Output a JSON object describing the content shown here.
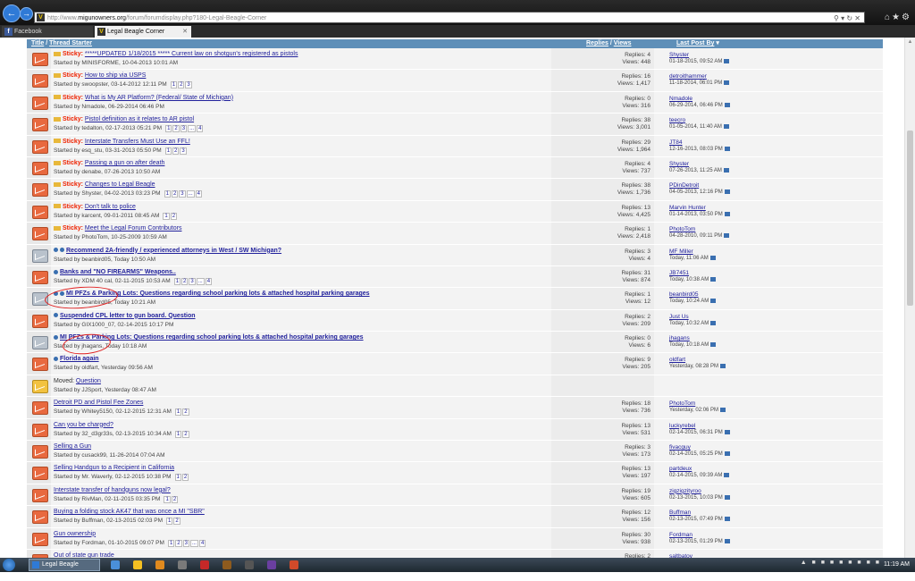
{
  "browser": {
    "url_prefix": "http://www.",
    "url_host": "migunowners.org",
    "url_path": "/forum/forumdisplay.php?180-Legal-Beagle-Corner",
    "tabs": [
      {
        "label": "Facebook"
      },
      {
        "label": "Legal Beagle Corner"
      }
    ]
  },
  "header": {
    "title": "Title",
    "thread_starter": "Thread Starter",
    "replies": "Replies",
    "views": "Views",
    "last_post_by": "Last Post By"
  },
  "threads": [
    {
      "icon": "red",
      "sticky": true,
      "folder": true,
      "title": "*****UPDATED 1/18/2015 ***** Current law on shotgun's registered as pistols",
      "started": "Started by MINISFORME, 10-04-2013 10:01 AM",
      "pages": [],
      "replies": "Replies: 4",
      "views": "Views: 448",
      "last_user": "Shyster",
      "last_date": "01-18-2015, 09:52 AM"
    },
    {
      "icon": "red",
      "sticky": true,
      "folder": true,
      "title": "How to ship via USPS",
      "started": "Started by swoopster, 03-14-2012 12:11 PM",
      "pages": [
        "1",
        "2",
        "3"
      ],
      "replies": "Replies: 16",
      "views": "Views: 1,417",
      "last_user": "detroithammer",
      "last_date": "11-18-2014, 06:01 PM"
    },
    {
      "icon": "red",
      "sticky": true,
      "folder": true,
      "title": "What is My AR Platform? (Federal/ State of Michigan)",
      "started": "Started by Nmadole, 06-29-2014 06:46 PM",
      "pages": [],
      "replies": "Replies: 0",
      "views": "Views: 316",
      "last_user": "Nmadole",
      "last_date": "06-29-2014, 06:46 PM"
    },
    {
      "icon": "red",
      "sticky": true,
      "folder": true,
      "title": "Pistol definition as it relates to AR pistol",
      "started": "Started by tedalton, 02-17-2013 05:21 PM",
      "pages": [
        "1",
        "2",
        "3",
        "...",
        "4"
      ],
      "replies": "Replies: 38",
      "views": "Views: 3,001",
      "last_user": "teecro",
      "last_date": "01-05-2014, 11:40 AM"
    },
    {
      "icon": "red",
      "sticky": true,
      "folder": true,
      "title": "Interstate Transfers Must Use an FFL!",
      "started": "Started by esq_stu, 03-31-2013 05:50 PM",
      "pages": [
        "1",
        "2",
        "3"
      ],
      "replies": "Replies: 29",
      "views": "Views: 1,964",
      "last_user": "JT84",
      "last_date": "12-16-2013, 08:03 PM"
    },
    {
      "icon": "red",
      "sticky": true,
      "folder": true,
      "title": "Passing a gun on after death",
      "started": "Started by denabe, 07-26-2013 10:50 AM",
      "pages": [],
      "replies": "Replies: 4",
      "views": "Views: 737",
      "last_user": "Shyster",
      "last_date": "07-26-2013, 11:25 AM"
    },
    {
      "icon": "red",
      "sticky": true,
      "folder": true,
      "title": "Changes to Legal Beagle",
      "started": "Started by Shyster, 04-02-2013 03:23 PM",
      "pages": [
        "1",
        "2",
        "3",
        "...",
        "4"
      ],
      "replies": "Replies: 38",
      "views": "Views: 1,736",
      "last_user": "PDinDetroit",
      "last_date": "04-05-2013, 12:16 PM"
    },
    {
      "icon": "red",
      "sticky": true,
      "folder": true,
      "title": "Don't talk to police",
      "started": "Started by karcent, 09-01-2011 08:45 AM",
      "pages": [
        "1",
        "2"
      ],
      "replies": "Replies: 13",
      "views": "Views: 4,425",
      "last_user": "Marvin Hunter",
      "last_date": "01-14-2013, 03:50 PM"
    },
    {
      "icon": "red",
      "sticky": true,
      "folder": true,
      "title": "Meet the Legal Forum Contributors",
      "started": "Started by PhotoTom, 10-25-2009 10:59 AM",
      "pages": [],
      "replies": "Replies: 1",
      "views": "Views: 2,418",
      "last_user": "PhotoTom",
      "last_date": "04-28-2010, 09:11 PM"
    },
    {
      "icon": "grey",
      "dots": 2,
      "bold": true,
      "title": "Recommend 2A-friendly / experienced attorneys in West / SW Michigan?",
      "started": "Started by beanbird05, Today 10:50 AM",
      "pages": [],
      "replies": "Replies: 3",
      "views": "Views: 4",
      "last_user": "MF Miller",
      "last_date": "Today, 11:06 AM"
    },
    {
      "icon": "red",
      "dots": 1,
      "bold": true,
      "title": "Banks and \"NO FIREARMS\" Weapons..",
      "started": "Started by XDM 40 cal, 02-11-2015 10:53 AM",
      "pages": [
        "1",
        "2",
        "3",
        "...",
        "4"
      ],
      "replies": "Replies: 31",
      "views": "Views: 874",
      "last_user": "JB7451",
      "last_date": "Today, 10:38 AM"
    },
    {
      "icon": "grey",
      "dots": 2,
      "bold": true,
      "title": "MI PFZs & Parking Lots: Questions regarding school parking lots & attached hospital parking garages",
      "started": "Started by beanbird05, Today 10:21 AM",
      "pages": [],
      "replies": "Replies: 1",
      "views": "Views: 12",
      "last_user": "beanbird05",
      "last_date": "Today, 10:24 AM"
    },
    {
      "icon": "red",
      "dots": 1,
      "bold": true,
      "title": "Suspended CPL letter to gun board. Question",
      "started": "Started by GIX1000_07, 02-14-2015 10:17 PM",
      "pages": [],
      "replies": "Replies: 2",
      "views": "Views: 209",
      "last_user": "Just Us",
      "last_date": "Today, 10:32 AM"
    },
    {
      "icon": "grey",
      "dots": 1,
      "bold": true,
      "title": "MI PFZs & Parking Lots: Questions regarding school parking lots & attached hospital parking garages",
      "started": "Started by jhagans, Today 10:18 AM",
      "pages": [],
      "replies": "Replies: 0",
      "views": "Views: 6",
      "last_user": "jhagans",
      "last_date": "Today, 10:18 AM"
    },
    {
      "icon": "red",
      "dots": 1,
      "bold": true,
      "title": "Florida again",
      "started": "Started by oldfart, Yesterday 09:56 AM",
      "pages": [],
      "replies": "Replies: 9",
      "views": "Views: 205",
      "last_user": "oldfart",
      "last_date": "Yesterday, 08:28 PM"
    },
    {
      "icon": "yellow",
      "moved": "Moved:",
      "title": "Question",
      "started": "Started by JJSport, Yesterday 08:47 AM",
      "pages": [],
      "replies": "",
      "views": "",
      "last_user": "",
      "last_date": ""
    },
    {
      "icon": "red",
      "title": "Detroit PD and Pistol Fee Zones",
      "started": "Started by Whitey5150, 02-12-2015 12:31 AM",
      "pages": [
        "1",
        "2"
      ],
      "replies": "Replies: 18",
      "views": "Views: 736",
      "last_user": "PhotoTom",
      "last_date": "Yesterday, 02:06 PM"
    },
    {
      "icon": "red",
      "title": "Can you be charged?",
      "started": "Started by 32_d3gr33s, 02-13-2015 10:34 AM",
      "pages": [
        "1",
        "2"
      ],
      "replies": "Replies: 13",
      "views": "Views: 531",
      "last_user": "luckyrebel",
      "last_date": "02-14-2015, 06:31 PM"
    },
    {
      "icon": "red",
      "title": "Selling a Gun",
      "started": "Started by cusack99, 11-26-2014 07:04 AM",
      "pages": [],
      "replies": "Replies: 3",
      "views": "Views: 173",
      "last_user": "fivacguy",
      "last_date": "02-14-2015, 05:25 PM"
    },
    {
      "icon": "red",
      "title": "Selling Handgun to a Recipient in California",
      "started": "Started by Mr. Waverly, 02-12-2015 10:38 PM",
      "pages": [
        "1",
        "2"
      ],
      "replies": "Replies: 13",
      "views": "Views: 197",
      "last_user": "partdeux",
      "last_date": "02-14-2015, 09:39 AM"
    },
    {
      "icon": "red",
      "title": "Interstate transfer of handguns now legal?",
      "started": "Started by RivMan, 02-11-2015 03:35 PM",
      "pages": [
        "1",
        "2"
      ],
      "replies": "Replies: 19",
      "views": "Views: 605",
      "last_user": "zigzigzityroo",
      "last_date": "02-13-2015, 10:03 PM"
    },
    {
      "icon": "red",
      "title": "Buying a folding stock AK47 that was once a MI \"SBR\"",
      "started": "Started by Buffman, 02-13-2015 02:03 PM",
      "pages": [
        "1",
        "2"
      ],
      "replies": "Replies: 12",
      "views": "Views: 156",
      "last_user": "Buffman",
      "last_date": "02-13-2015, 07:49 PM"
    },
    {
      "icon": "red",
      "title": "Gun ownership",
      "started": "Started by Fordman, 01-10-2015 09:07 PM",
      "pages": [
        "1",
        "2",
        "3",
        "...",
        "4"
      ],
      "replies": "Replies: 30",
      "views": "Views: 938",
      "last_user": "Fordman",
      "last_date": "02-13-2015, 01:29 PM"
    },
    {
      "icon": "red",
      "title": "Out of state gun trade",
      "started": "",
      "pages": [],
      "replies": "Replies: 2",
      "views": "",
      "last_user": "saltbatov",
      "last_date": ""
    }
  ],
  "taskbar": {
    "window_label": "Legal Beagle Corner ...",
    "clock": "11:19 AM"
  }
}
